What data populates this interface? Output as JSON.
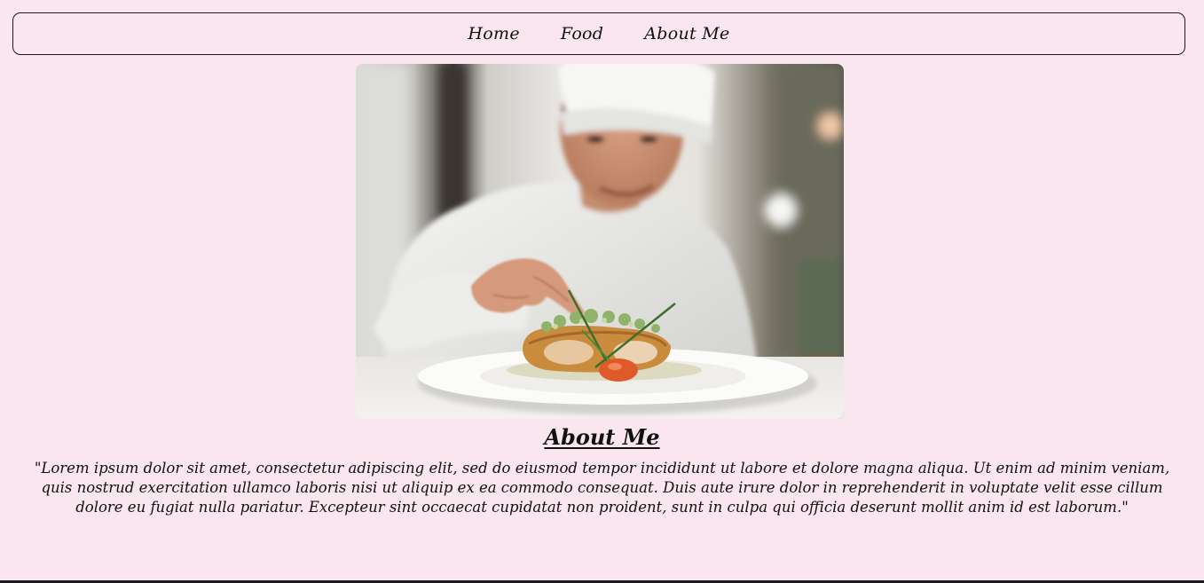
{
  "nav": {
    "items": [
      {
        "label": "Home"
      },
      {
        "label": "Food"
      },
      {
        "label": "About Me"
      }
    ]
  },
  "hero": {
    "image_subject": "chef-plating-dish-photo"
  },
  "about": {
    "heading": "About Me",
    "paragraph": "\"Lorem ipsum dolor sit amet, consectetur adipiscing elit, sed do eiusmod tempor incididunt ut labore et dolore magna aliqua. Ut enim ad minim veniam, quis nostrud exercitation ullamco laboris nisi ut aliquip ex ea commodo consequat. Duis aute irure dolor in reprehenderit in voluptate velit esse cillum dolore eu fugiat nulla pariatur. Excepteur sint occaecat cupidatat non proident, sunt in culpa qui officia deserunt mollit anim id est laborum.\""
  },
  "colors": {
    "background": "#fae6ef",
    "text": "#111111",
    "border": "#1a1a1a"
  }
}
